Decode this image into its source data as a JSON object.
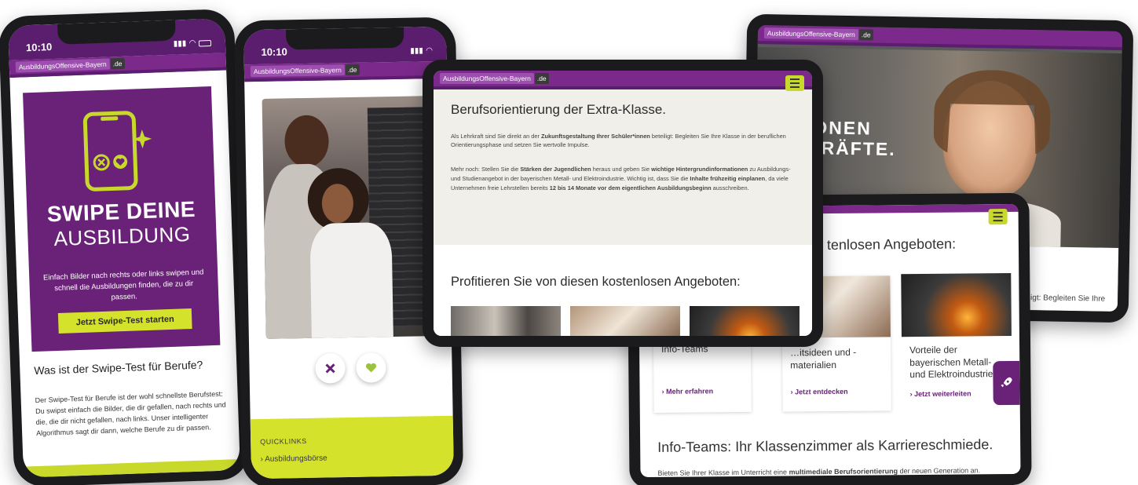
{
  "brand": {
    "name": "AusbildungsOffensive-Bayern",
    "tld": ".de"
  },
  "colors": {
    "purple": "#6a2279",
    "dark_purple": "#5b1d6e",
    "lime": "#d4e22b"
  },
  "phone1": {
    "time": "10:10",
    "hero_title": "SWIPE DEINE",
    "hero_subtitle": "AUSBILDUNG",
    "hero_text": "Einfach Bilder nach rechts oder links swipen und schnell die Ausbildungen finden, die zu dir passen.",
    "cta": "Jetzt Swipe-Test starten",
    "section_title": "Was ist der Swipe-Test für Berufe?",
    "section_text": "Der Swipe-Test für Berufe ist der wohl schnellste Berufstest: Du swipst einfach die Bilder, die dir gefallen, nach rechts und die, die dir nicht gefallen, nach links. Unser intelligenter Algorithmus sagt dir dann, welche Berufe zu dir passen.",
    "icons": [
      "phone-icon",
      "close-circle-icon",
      "heart-circle-icon",
      "sparkle-icon"
    ]
  },
  "phone2": {
    "time": "10:10",
    "quicklinks_title": "QUICKLINKS",
    "quicklinks": [
      "Ausbildungsbörse"
    ],
    "icons": [
      "close-icon",
      "heart-icon",
      "chevron-right-icon"
    ]
  },
  "tablet_main": {
    "headline": "Berufsorientierung der Extra-Klasse.",
    "para1_pre": "Als Lehrkraft sind Sie direkt an der ",
    "para1_bold": "Zukunftsgestaltung Ihrer Schüler*innen",
    "para1_post": " beteiligt: Begleiten Sie Ihre Klasse in der beruflichen Orientierungsphase und setzen Sie wertvolle Impulse.",
    "para2_a": "Mehr noch: Stellen Sie die ",
    "para2_b": "Stärken der Jugendlichen",
    "para2_c": " heraus und geben Sie ",
    "para2_d": "wichtige Hintergrundinformationen",
    "para2_e": " zu Ausbildungs- und Studienangebot in der bayerischen Metall- und Elektroindustrie. Wichtig ist, dass Sie die ",
    "para2_f": "Inhalte frühzeitig einplanen",
    "para2_g": ", da viele Unternehmen freie Lehrstellen bereits ",
    "para2_h": "12 bis 14 Monate vor dem eigentlichen Ausbildungsbeginn",
    "para2_i": " ausschreiben.",
    "offers_title": "Profitieren Sie von diesen kostenlosen Angeboten:"
  },
  "tablet_back": {
    "hero_line1": "MATIONEN",
    "hero_line2": "EHRKRÄFTE.",
    "snippet": "ligt: Begleiten Sie Ihre"
  },
  "tablet_front": {
    "offers_title_partial": "tenlosen Angeboten:",
    "cards": [
      {
        "title": "Info-Teams",
        "link": "Mehr erfahren"
      },
      {
        "title": "…itsideen und -materialien",
        "link": "Jetzt entdecken"
      },
      {
        "title": "Vorteile der bayerischen Metall- und Elektroindustrie",
        "link": "Jetzt weiterleiten"
      }
    ],
    "section_title": "Info-Teams: Ihr Klassenzimmer als Karriereschmiede.",
    "section_text_pre": "Bieten Sie Ihrer Klasse im Unterricht eine ",
    "section_text_bold": "multimediale Berufsorientierung",
    "section_text_post": " der neuen Generation an.",
    "icons": [
      "rocket-icon"
    ]
  }
}
